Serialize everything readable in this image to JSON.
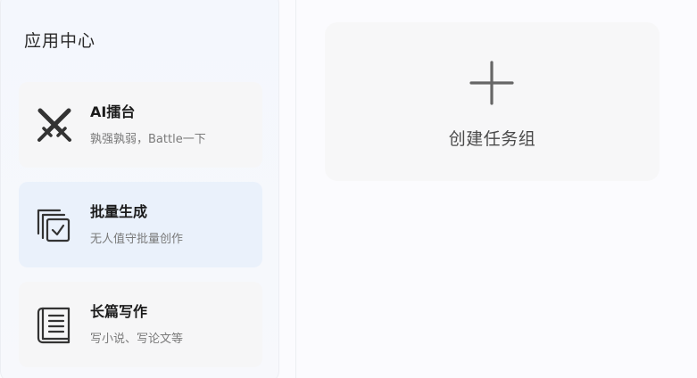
{
  "sidebar": {
    "title": "应用中心",
    "items": [
      {
        "icon": "crossed-swords-icon",
        "title": "AI擂台",
        "desc": "孰强孰弱，Battle一下",
        "active": false
      },
      {
        "icon": "batch-generate-icon",
        "title": "批量生成",
        "desc": "无人值守批量创作",
        "active": true
      },
      {
        "icon": "book-icon",
        "title": "长篇写作",
        "desc": "写小说、写论文等",
        "active": false
      }
    ]
  },
  "main": {
    "create_card": {
      "icon": "plus-icon",
      "label": "创建任务组"
    }
  },
  "colors": {
    "sidebar_bg": "#f5f7fd",
    "active_card_bg": "#eaf1fb",
    "card_bg": "#f6f6f7",
    "create_card_bg": "#f7f7f8"
  }
}
